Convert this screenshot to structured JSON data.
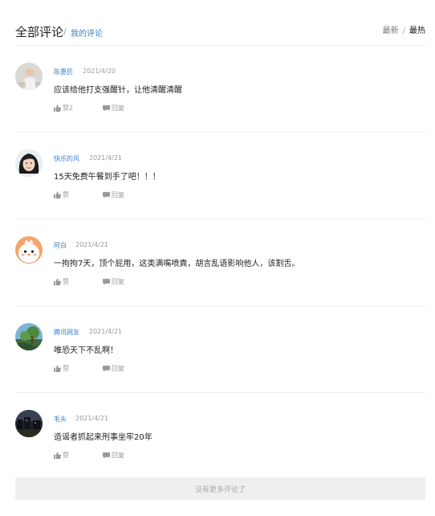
{
  "header": {
    "title": "全部评论",
    "separator": "/",
    "mine_label": "我的评论",
    "sort_newest": "最新",
    "sort_divider": "/",
    "sort_hot": "最热"
  },
  "comments": [
    {
      "user": "陈惠民",
      "date": "2021/4/20",
      "text": "应该给他打支强醒针，让他清醒清醒",
      "like_label": "赞2",
      "reply_label": "回复",
      "avatar_icon": "person-photo-avatar"
    },
    {
      "user": "快乐的风",
      "date": "2021/4/21",
      "text": "15天免费午餐到手了吧！！！",
      "like_label": "赞",
      "reply_label": "回复",
      "avatar_icon": "woman-photo-avatar"
    },
    {
      "user": "阿白",
      "date": "2021/4/21",
      "text": "一拘拘7天，顶个屁用，这类满嘴喷粪，胡言乱语影响他人，该割舌。",
      "like_label": "赞",
      "reply_label": "回复",
      "avatar_icon": "cartoon-chick-avatar"
    },
    {
      "user": "腾讯网友",
      "date": "2021/4/21",
      "text": "唯恐天下不乱啊！",
      "like_label": "赞",
      "reply_label": "回复",
      "avatar_icon": "landscape-photo-avatar"
    },
    {
      "user": "毛头",
      "date": "2021/4/21",
      "text": "造谣者抓起来刑事坐牢20年",
      "like_label": "赞",
      "reply_label": "回复",
      "avatar_icon": "night-scene-avatar"
    }
  ],
  "footer": {
    "no_more": "没有更多评论了"
  },
  "colors": {
    "link": "#3a7fcf",
    "divider": "#ececec",
    "footer_bg": "#efefef"
  }
}
